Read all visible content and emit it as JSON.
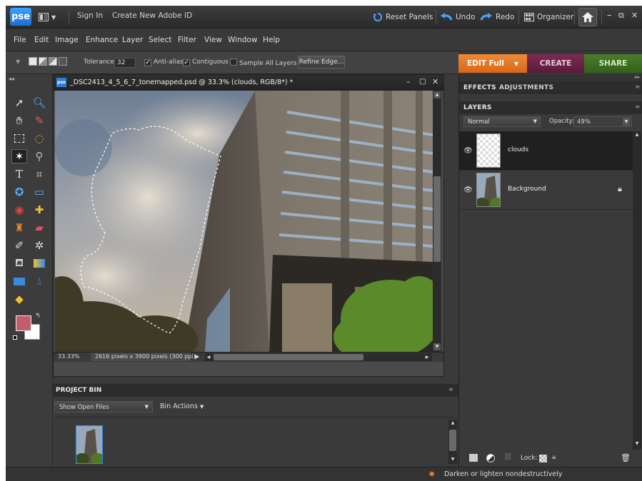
{
  "app": {
    "logo": "pse",
    "sign_in": "Sign In",
    "create_id": "Create New Adobe ID",
    "reset_panels": "Reset Panels",
    "undo": "Undo",
    "redo": "Redo",
    "organizer": "Organizer",
    "win_min": "–",
    "win_restore": "⧉",
    "win_close": "✕"
  },
  "menu": {
    "items": [
      "File",
      "Edit",
      "Image",
      "Enhance",
      "Layer",
      "Select",
      "Filter",
      "View",
      "Window",
      "Help"
    ]
  },
  "options": {
    "tolerance_label": "Tolerance:",
    "tolerance_value": "32",
    "anti_alias": "Anti-alias",
    "contiguous": "Contiguous",
    "sample_all": "Sample All Layers",
    "refine_edge": "Refine Edge..."
  },
  "modes": {
    "edit": "EDIT Full",
    "create": "CREATE",
    "share": "SHARE"
  },
  "document": {
    "title": "_DSC2413_4_5_6_7_tonemapped.psd @ 33.3% (clouds, RGB/8*) *",
    "zoom": "33.33%",
    "dimensions": "2616 pixels x 3900 pixels (300 ppi)",
    "doc_badge": "pse"
  },
  "bin": {
    "header": "PROJECT BIN",
    "dropdown": "Show Open Files",
    "actions": "Bin Actions"
  },
  "panel": {
    "tab_effects": "EFFECTS",
    "tab_adjustments": "ADJUSTMENTS",
    "layers_title": "LAYERS",
    "blend_mode": "Normal",
    "opacity_label": "Opacity:",
    "opacity_value": "49%",
    "lock_label": "Lock:",
    "layers": [
      {
        "name": "clouds"
      },
      {
        "name": "Background"
      }
    ]
  },
  "status": {
    "hint": "Darken or lighten nondestructively"
  },
  "colors": {
    "foreground": "#c25d6c",
    "background": "#ffffff",
    "edit_tab": "#e87722",
    "create_tab": "#6a2147",
    "share_tab": "#3f6b22",
    "accent_blue": "#3a8be0"
  },
  "icons": [
    "move-icon",
    "zoom-icon",
    "hand-icon",
    "eyedropper-icon",
    "marquee-icon",
    "lasso-icon",
    "magic-wand-icon",
    "quick-selection-icon",
    "type-icon",
    "crop-icon",
    "cookie-cutter-icon",
    "straighten-icon",
    "red-eye-icon",
    "healing-icon",
    "clone-stamp-icon",
    "eraser-icon",
    "brush-icon",
    "smart-brush-icon",
    "paint-bucket-icon",
    "gradient-icon",
    "shape-icon",
    "blur-icon",
    "sponge-icon"
  ]
}
